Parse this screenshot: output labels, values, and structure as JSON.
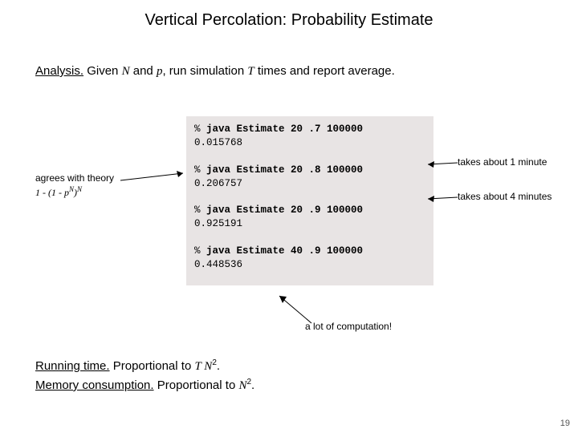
{
  "title": "Vertical Percolation:  Probability Estimate",
  "analysis": {
    "label": "Analysis.",
    "pre": "  Given ",
    "var1": "N",
    "mid1": " and ",
    "var2": "p",
    "mid2": ", run simulation ",
    "var3": "T",
    "post": " times and report average."
  },
  "code": {
    "l1a": "% ",
    "l1b": "java Estimate 20 .7 100000",
    "l2": "0.015768",
    "l3a": "% ",
    "l3b": "java Estimate 20 .8 100000",
    "l4": "0.206757",
    "l5a": "% ",
    "l5b": "java Estimate 20 .9 100000",
    "l6": "0.925191",
    "l7a": "% ",
    "l7b": "java Estimate 40 .9 100000",
    "l8": "0.448536"
  },
  "left_note": {
    "line1": "agrees with theory",
    "formula_a": "1 - (1 - ",
    "formula_pN": "p",
    "formula_supN": "N",
    "formula_b": ")",
    "formula_supN2": "N"
  },
  "right_note1": "takes about 1 minute",
  "right_note2": "takes about 4 minutes",
  "bottom_note": "a lot of computation!",
  "running": {
    "label1": "Running time.",
    "text1a": "  Proportional to ",
    "var_T": "T",
    "var_N": " N",
    "sup2": "2",
    "text1b": ".",
    "label2": "Memory consumption.",
    "text2a": "  Proportional to ",
    "var_N2": "N",
    "sup2b": "2",
    "text2b": "."
  },
  "pagenum": "19"
}
